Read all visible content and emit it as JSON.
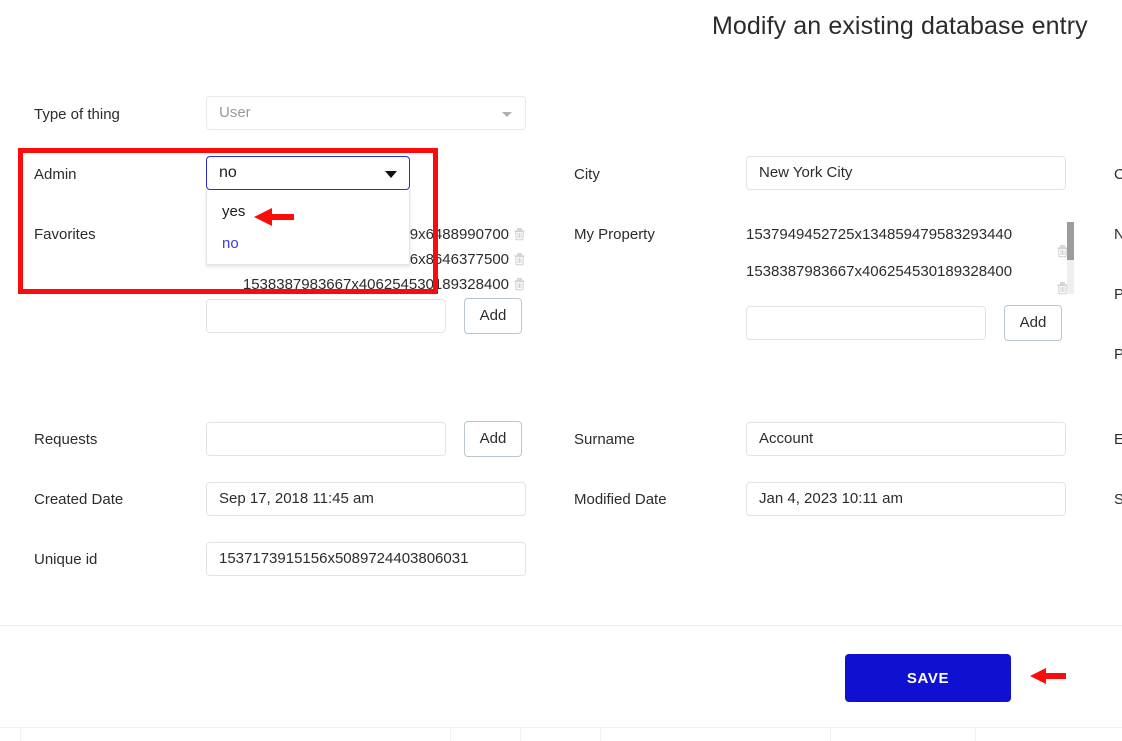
{
  "header": {
    "title": "Modify an existing database entry"
  },
  "form": {
    "type_of_thing": {
      "label": "Type of thing",
      "value": "User"
    },
    "admin": {
      "label": "Admin",
      "value": "no",
      "options": [
        "yes",
        "no"
      ],
      "selected": "no"
    },
    "favorites": {
      "label": "Favorites",
      "items": [
        "1538295164689x6488990700",
        "1538296018646x8646377500",
        "1538387983667x406254530189328400"
      ],
      "input_value": "",
      "add_label": "Add"
    },
    "requests": {
      "label": "Requests",
      "input_value": "",
      "add_label": "Add"
    },
    "created_date": {
      "label": "Created Date",
      "value": "Sep 17, 2018 11:45 am"
    },
    "unique_id": {
      "label": "Unique id",
      "value": "1537173915156x5089724403806031"
    },
    "city": {
      "label": "City",
      "value": "New York City"
    },
    "my_property": {
      "label": "My Property",
      "items": [
        "1537949452725x134859479583293440",
        "1538387983667x406254530189328400"
      ],
      "input_value": "",
      "add_label": "Add"
    },
    "surname": {
      "label": "Surname",
      "value": "Account"
    },
    "modified_date": {
      "label": "Modified Date",
      "value": "Jan 4, 2023 10:11 am"
    },
    "clipped_column_labels": [
      "C",
      "N",
      "P",
      "P",
      "E",
      "S"
    ]
  },
  "footer": {
    "save_label": "SAVE"
  },
  "colors": {
    "accent_blue": "#1010d2",
    "focus_blue": "#2b2bd8",
    "annotation_red": "#fc0b0b",
    "option_selected": "#3a3af0"
  }
}
